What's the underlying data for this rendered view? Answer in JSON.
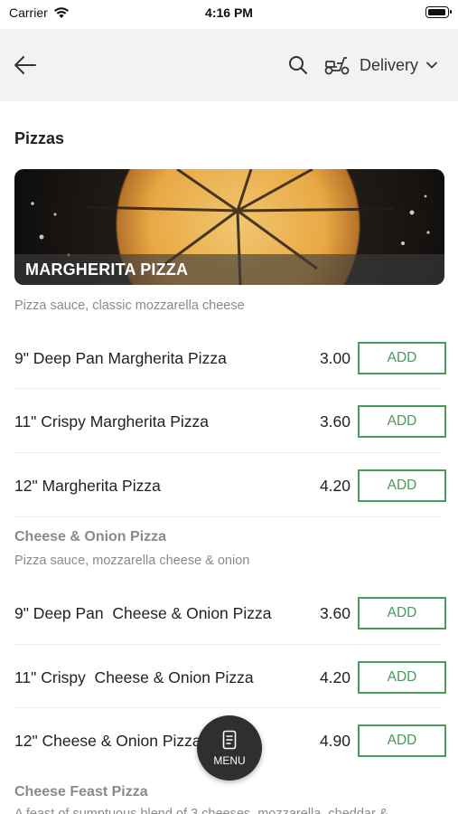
{
  "status_bar": {
    "carrier": "Carrier",
    "time": "4:16 PM"
  },
  "header": {
    "delivery_label": "Delivery"
  },
  "section": {
    "title": "Pizzas"
  },
  "banner": {
    "label": "MARGHERITA PIZZA"
  },
  "groups": [
    {
      "description": "Pizza sauce, classic mozzarella cheese",
      "items": [
        {
          "name": "9\" Deep Pan Margherita Pizza",
          "price": "3.00",
          "add_label": "ADD"
        },
        {
          "name": "11\" Crispy Margherita Pizza",
          "price": "3.60",
          "add_label": "ADD"
        },
        {
          "name": "12\" Margherita Pizza",
          "price": "4.20",
          "add_label": "ADD"
        }
      ]
    },
    {
      "title": "Cheese & Onion Pizza",
      "description": "Pizza sauce, mozzarella cheese & onion",
      "items": [
        {
          "name": "9\" Deep Pan  Cheese & Onion Pizza",
          "price": "3.60",
          "add_label": "ADD"
        },
        {
          "name": "11\" Crispy  Cheese & Onion Pizza",
          "price": "4.20",
          "add_label": "ADD"
        },
        {
          "name": "12\" Cheese & Onion Pizza",
          "price": "4.90",
          "add_label": "ADD"
        }
      ]
    },
    {
      "title": "Cheese Feast Pizza",
      "description": "A feast of sumptuous blend of 3 cheeses, mozzarella, cheddar &"
    }
  ],
  "fab": {
    "label": "MENU"
  },
  "colors": {
    "accent": "#4a9a5a",
    "header_bg": "#f2f2f2",
    "fab_bg": "#2f2f2f",
    "muted_text": "#8a8a8a"
  },
  "icons": {
    "back": "arrow-left-icon",
    "search": "search-icon",
    "delivery": "scooter-icon",
    "dropdown": "chevron-down-icon",
    "menu": "menu-document-icon"
  }
}
